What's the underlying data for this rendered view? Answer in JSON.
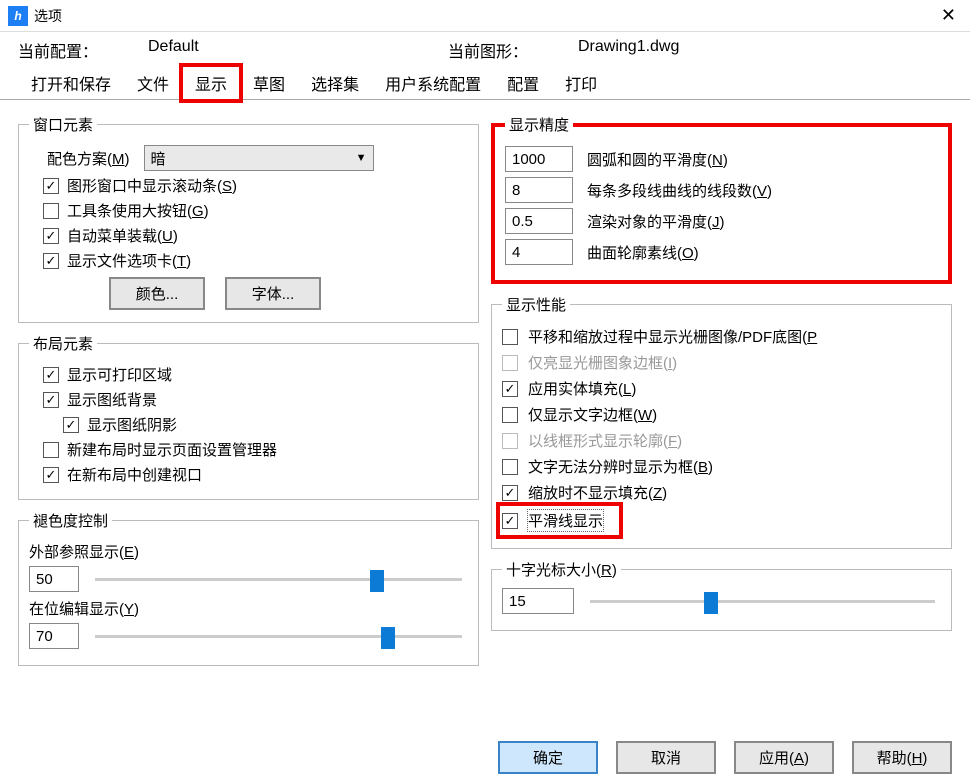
{
  "window": {
    "title": "选项"
  },
  "config": {
    "profile_label": "当前配置：",
    "profile_value": "Default",
    "drawing_label": "当前图形：",
    "drawing_value": "Drawing1.dwg"
  },
  "tabs": {
    "open_save": "打开和保存",
    "file": "文件",
    "display": "显示",
    "sketch": "草图",
    "selection": "选择集",
    "user_sys": "用户系统配置",
    "config": "配置",
    "print": "打印"
  },
  "window_elements": {
    "legend": "窗口元素",
    "color_scheme_label": "配色方案(",
    "color_scheme_key": "M",
    "color_scheme_close": ")",
    "color_scheme_value": "暗",
    "scrollbars": "图形窗口中显示滚动条(",
    "scrollbars_key": "S",
    "large_buttons": "工具条使用大按钮(",
    "large_buttons_key": "G",
    "auto_menu": "自动菜单装载(",
    "auto_menu_key": "U",
    "file_tabs": "显示文件选项卡(",
    "file_tabs_key": "T",
    "close_paren": ")",
    "color_btn": "颜色...",
    "font_btn": "字体..."
  },
  "layout_elements": {
    "legend": "布局元素",
    "printable": "显示可打印区域",
    "paper_bg": "显示图纸背景",
    "paper_shadow": "显示图纸阴影",
    "page_setup": "新建布局时显示页面设置管理器",
    "create_viewport": "在新布局中创建视口"
  },
  "fade_control": {
    "legend": "褪色度控制",
    "xref_label": "外部参照显示(",
    "xref_key": "E",
    "xref_value": "50",
    "inplace_label": "在位编辑显示(",
    "inplace_key": "Y",
    "inplace_value": "70",
    "close_paren": ")"
  },
  "precision": {
    "legend": "显示精度",
    "arc_val": "1000",
    "arc_lbl": "圆弧和圆的平滑度(",
    "arc_key": "N",
    "poly_val": "8",
    "poly_lbl": "每条多段线曲线的线段数(",
    "poly_key": "V",
    "render_val": "0.5",
    "render_lbl": "渲染对象的平滑度(",
    "render_key": "J",
    "surf_val": "4",
    "surf_lbl": "曲面轮廓素线(",
    "surf_key": "O",
    "close_paren": ")"
  },
  "performance": {
    "legend": "显示性能",
    "pan_raster": "平移和缩放过程中显示光栅图像/PDF底图(",
    "pan_raster_key": "P",
    "highlight_raster": "仅亮显光栅图象边框(",
    "highlight_raster_key": "I",
    "solid_fill": "应用实体填充(",
    "solid_fill_key": "L",
    "text_frame": "仅显示文字边框(",
    "text_frame_key": "W",
    "wireframe": "以线框形式显示轮廓(",
    "wireframe_key": "F",
    "text_box": "文字无法分辨时显示为框(",
    "text_box_key": "B",
    "no_fill_zoom": "缩放时不显示填充(",
    "no_fill_zoom_key": "Z",
    "smooth_line": "平滑线显示",
    "close_paren": ")"
  },
  "crosshair": {
    "legend": "十字光标大小(",
    "legend_key": "R",
    "legend_close": ")",
    "value": "15"
  },
  "footer": {
    "ok": "确定",
    "cancel": "取消",
    "apply": "应用(",
    "apply_key": "A",
    "help": "帮助(",
    "help_key": "H",
    "close_paren": ")"
  }
}
